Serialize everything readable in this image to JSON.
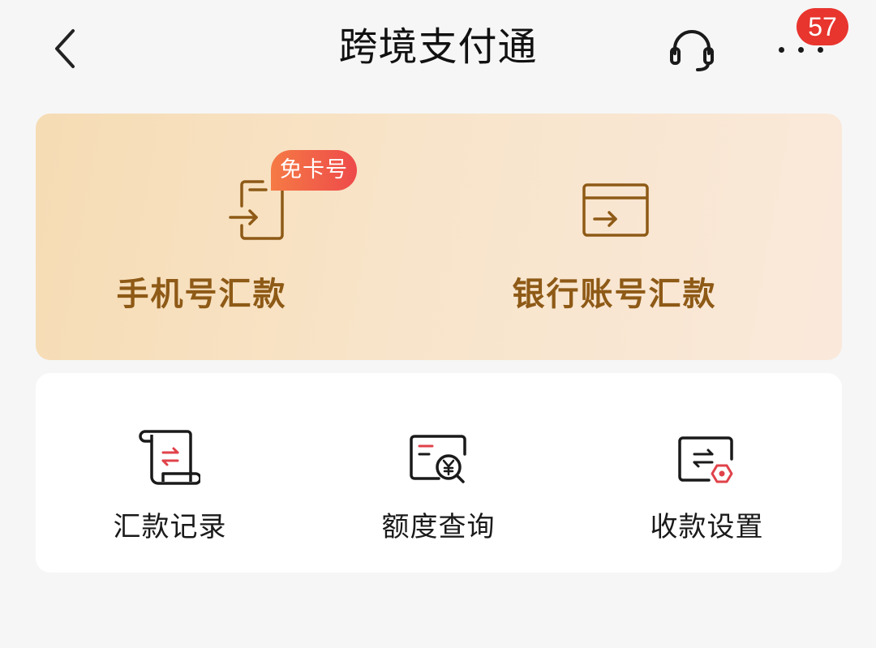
{
  "header": {
    "title": "跨境支付通",
    "back_icon": "chevron-left-icon",
    "support_icon": "headset-icon",
    "more_icon": "more-dots-icon",
    "notification_count": "57"
  },
  "transfer": {
    "phone": {
      "label": "手机号汇款",
      "tag": "免卡号",
      "icon": "phone-transfer-icon"
    },
    "bank": {
      "label": "银行账号汇款",
      "icon": "bank-card-transfer-icon"
    }
  },
  "services": {
    "items": [
      {
        "label": "汇款记录",
        "icon": "remittance-record-icon"
      },
      {
        "label": "额度查询",
        "icon": "quota-query-icon"
      },
      {
        "label": "收款设置",
        "icon": "receipt-settings-icon"
      }
    ]
  },
  "colors": {
    "accent_brown": "#8e5a16",
    "icon_red": "#e0424a",
    "badge_red": "#e8352e",
    "tag_gradient_start": "#f57a45",
    "tag_gradient_end": "#ee4a4a",
    "page_background": "#f6f6f6"
  }
}
